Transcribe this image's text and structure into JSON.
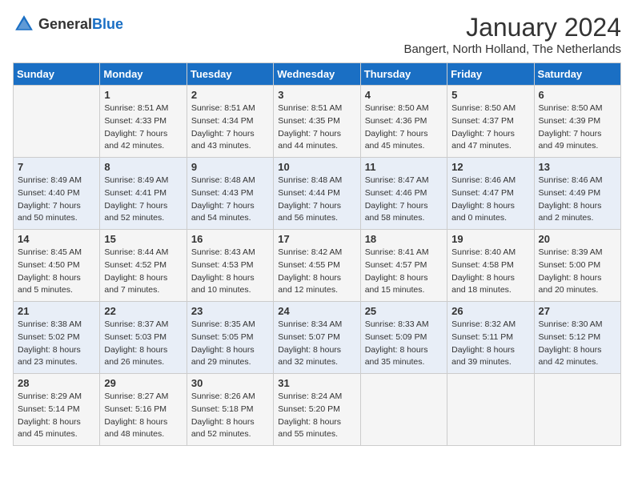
{
  "header": {
    "logo_general": "General",
    "logo_blue": "Blue",
    "month_title": "January 2024",
    "location": "Bangert, North Holland, The Netherlands"
  },
  "days_of_week": [
    "Sunday",
    "Monday",
    "Tuesday",
    "Wednesday",
    "Thursday",
    "Friday",
    "Saturday"
  ],
  "weeks": [
    [
      {
        "day": "",
        "sunrise": "",
        "sunset": "",
        "daylight": ""
      },
      {
        "day": "1",
        "sunrise": "Sunrise: 8:51 AM",
        "sunset": "Sunset: 4:33 PM",
        "daylight": "Daylight: 7 hours and 42 minutes."
      },
      {
        "day": "2",
        "sunrise": "Sunrise: 8:51 AM",
        "sunset": "Sunset: 4:34 PM",
        "daylight": "Daylight: 7 hours and 43 minutes."
      },
      {
        "day": "3",
        "sunrise": "Sunrise: 8:51 AM",
        "sunset": "Sunset: 4:35 PM",
        "daylight": "Daylight: 7 hours and 44 minutes."
      },
      {
        "day": "4",
        "sunrise": "Sunrise: 8:50 AM",
        "sunset": "Sunset: 4:36 PM",
        "daylight": "Daylight: 7 hours and 45 minutes."
      },
      {
        "day": "5",
        "sunrise": "Sunrise: 8:50 AM",
        "sunset": "Sunset: 4:37 PM",
        "daylight": "Daylight: 7 hours and 47 minutes."
      },
      {
        "day": "6",
        "sunrise": "Sunrise: 8:50 AM",
        "sunset": "Sunset: 4:39 PM",
        "daylight": "Daylight: 7 hours and 49 minutes."
      }
    ],
    [
      {
        "day": "7",
        "sunrise": "Sunrise: 8:49 AM",
        "sunset": "Sunset: 4:40 PM",
        "daylight": "Daylight: 7 hours and 50 minutes."
      },
      {
        "day": "8",
        "sunrise": "Sunrise: 8:49 AM",
        "sunset": "Sunset: 4:41 PM",
        "daylight": "Daylight: 7 hours and 52 minutes."
      },
      {
        "day": "9",
        "sunrise": "Sunrise: 8:48 AM",
        "sunset": "Sunset: 4:43 PM",
        "daylight": "Daylight: 7 hours and 54 minutes."
      },
      {
        "day": "10",
        "sunrise": "Sunrise: 8:48 AM",
        "sunset": "Sunset: 4:44 PM",
        "daylight": "Daylight: 7 hours and 56 minutes."
      },
      {
        "day": "11",
        "sunrise": "Sunrise: 8:47 AM",
        "sunset": "Sunset: 4:46 PM",
        "daylight": "Daylight: 7 hours and 58 minutes."
      },
      {
        "day": "12",
        "sunrise": "Sunrise: 8:46 AM",
        "sunset": "Sunset: 4:47 PM",
        "daylight": "Daylight: 8 hours and 0 minutes."
      },
      {
        "day": "13",
        "sunrise": "Sunrise: 8:46 AM",
        "sunset": "Sunset: 4:49 PM",
        "daylight": "Daylight: 8 hours and 2 minutes."
      }
    ],
    [
      {
        "day": "14",
        "sunrise": "Sunrise: 8:45 AM",
        "sunset": "Sunset: 4:50 PM",
        "daylight": "Daylight: 8 hours and 5 minutes."
      },
      {
        "day": "15",
        "sunrise": "Sunrise: 8:44 AM",
        "sunset": "Sunset: 4:52 PM",
        "daylight": "Daylight: 8 hours and 7 minutes."
      },
      {
        "day": "16",
        "sunrise": "Sunrise: 8:43 AM",
        "sunset": "Sunset: 4:53 PM",
        "daylight": "Daylight: 8 hours and 10 minutes."
      },
      {
        "day": "17",
        "sunrise": "Sunrise: 8:42 AM",
        "sunset": "Sunset: 4:55 PM",
        "daylight": "Daylight: 8 hours and 12 minutes."
      },
      {
        "day": "18",
        "sunrise": "Sunrise: 8:41 AM",
        "sunset": "Sunset: 4:57 PM",
        "daylight": "Daylight: 8 hours and 15 minutes."
      },
      {
        "day": "19",
        "sunrise": "Sunrise: 8:40 AM",
        "sunset": "Sunset: 4:58 PM",
        "daylight": "Daylight: 8 hours and 18 minutes."
      },
      {
        "day": "20",
        "sunrise": "Sunrise: 8:39 AM",
        "sunset": "Sunset: 5:00 PM",
        "daylight": "Daylight: 8 hours and 20 minutes."
      }
    ],
    [
      {
        "day": "21",
        "sunrise": "Sunrise: 8:38 AM",
        "sunset": "Sunset: 5:02 PM",
        "daylight": "Daylight: 8 hours and 23 minutes."
      },
      {
        "day": "22",
        "sunrise": "Sunrise: 8:37 AM",
        "sunset": "Sunset: 5:03 PM",
        "daylight": "Daylight: 8 hours and 26 minutes."
      },
      {
        "day": "23",
        "sunrise": "Sunrise: 8:35 AM",
        "sunset": "Sunset: 5:05 PM",
        "daylight": "Daylight: 8 hours and 29 minutes."
      },
      {
        "day": "24",
        "sunrise": "Sunrise: 8:34 AM",
        "sunset": "Sunset: 5:07 PM",
        "daylight": "Daylight: 8 hours and 32 minutes."
      },
      {
        "day": "25",
        "sunrise": "Sunrise: 8:33 AM",
        "sunset": "Sunset: 5:09 PM",
        "daylight": "Daylight: 8 hours and 35 minutes."
      },
      {
        "day": "26",
        "sunrise": "Sunrise: 8:32 AM",
        "sunset": "Sunset: 5:11 PM",
        "daylight": "Daylight: 8 hours and 39 minutes."
      },
      {
        "day": "27",
        "sunrise": "Sunrise: 8:30 AM",
        "sunset": "Sunset: 5:12 PM",
        "daylight": "Daylight: 8 hours and 42 minutes."
      }
    ],
    [
      {
        "day": "28",
        "sunrise": "Sunrise: 8:29 AM",
        "sunset": "Sunset: 5:14 PM",
        "daylight": "Daylight: 8 hours and 45 minutes."
      },
      {
        "day": "29",
        "sunrise": "Sunrise: 8:27 AM",
        "sunset": "Sunset: 5:16 PM",
        "daylight": "Daylight: 8 hours and 48 minutes."
      },
      {
        "day": "30",
        "sunrise": "Sunrise: 8:26 AM",
        "sunset": "Sunset: 5:18 PM",
        "daylight": "Daylight: 8 hours and 52 minutes."
      },
      {
        "day": "31",
        "sunrise": "Sunrise: 8:24 AM",
        "sunset": "Sunset: 5:20 PM",
        "daylight": "Daylight: 8 hours and 55 minutes."
      },
      {
        "day": "",
        "sunrise": "",
        "sunset": "",
        "daylight": ""
      },
      {
        "day": "",
        "sunrise": "",
        "sunset": "",
        "daylight": ""
      },
      {
        "day": "",
        "sunrise": "",
        "sunset": "",
        "daylight": ""
      }
    ]
  ]
}
